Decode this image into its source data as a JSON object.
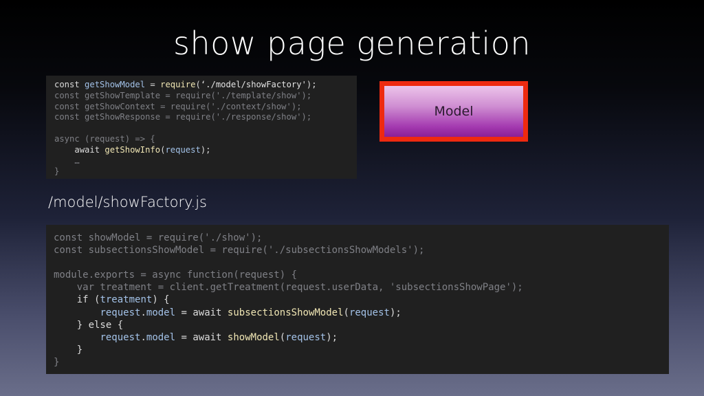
{
  "slide": {
    "title": "show page generation",
    "file_label": "/model/showFactory.js",
    "model_label": "Model"
  },
  "colors": {
    "model_border": "#ee2a10",
    "model_fill_top": "#ecc4ea",
    "model_fill_bottom": "#8a1f97",
    "code_background": "#202020"
  },
  "code_top": [
    {
      "indent": "",
      "parts": [
        {
          "t": "const ",
          "c": "hl"
        },
        {
          "t": "getShowModel",
          "c": "id"
        },
        {
          "t": " = ",
          "c": "hl"
        },
        {
          "t": "require",
          "c": "fn"
        },
        {
          "t": "(",
          "c": "hl"
        },
        {
          "t": "‘./model/showFactory'",
          "c": "str"
        },
        {
          "t": ");",
          "c": "hl"
        }
      ]
    },
    {
      "indent": "",
      "parts": [
        {
          "t": "const getShowTemplate = require('./template/show');",
          "c": ""
        }
      ]
    },
    {
      "indent": "",
      "parts": [
        {
          "t": "const getShowContext = require('./context/show');",
          "c": ""
        }
      ]
    },
    {
      "indent": "",
      "parts": [
        {
          "t": "const getShowResponse = require('./response/show');",
          "c": ""
        }
      ]
    },
    {
      "indent": "",
      "parts": [
        {
          "t": "",
          "c": ""
        }
      ]
    },
    {
      "indent": "",
      "parts": [
        {
          "t": "async (request) => {",
          "c": ""
        }
      ]
    },
    {
      "indent": "    ",
      "parts": [
        {
          "t": "await ",
          "c": "hl"
        },
        {
          "t": "getShowInfo",
          "c": "fn"
        },
        {
          "t": "(",
          "c": "hl"
        },
        {
          "t": "request",
          "c": "id"
        },
        {
          "t": ");",
          "c": "hl"
        }
      ]
    },
    {
      "indent": "    ",
      "parts": [
        {
          "t": "…",
          "c": ""
        }
      ]
    },
    {
      "indent": "",
      "parts": [
        {
          "t": "}",
          "c": ""
        }
      ]
    }
  ],
  "code_bottom": [
    {
      "indent": "",
      "parts": [
        {
          "t": "const showModel = require('./show');",
          "c": ""
        }
      ]
    },
    {
      "indent": "",
      "parts": [
        {
          "t": "const subsectionsShowModel = require('./subsectionsShowModels');",
          "c": ""
        }
      ]
    },
    {
      "indent": "",
      "parts": [
        {
          "t": "",
          "c": ""
        }
      ]
    },
    {
      "indent": "",
      "parts": [
        {
          "t": "module.exports = async function(request) {",
          "c": ""
        }
      ]
    },
    {
      "indent": "    ",
      "parts": [
        {
          "t": "var treatment = client.getTreatment(request.userData, 'subsectionsShowPage');",
          "c": ""
        }
      ]
    },
    {
      "indent": "    ",
      "parts": [
        {
          "t": "if ",
          "c": "hl"
        },
        {
          "t": "(",
          "c": "hl"
        },
        {
          "t": "treatment",
          "c": "id"
        },
        {
          "t": ") {",
          "c": "hl"
        }
      ]
    },
    {
      "indent": "        ",
      "parts": [
        {
          "t": "request",
          "c": "id"
        },
        {
          "t": ".",
          "c": "hl"
        },
        {
          "t": "model",
          "c": "id"
        },
        {
          "t": " = ",
          "c": "hl"
        },
        {
          "t": "await ",
          "c": "hl"
        },
        {
          "t": "subsectionsShowModel",
          "c": "fn"
        },
        {
          "t": "(",
          "c": "hl"
        },
        {
          "t": "request",
          "c": "id"
        },
        {
          "t": ");",
          "c": "hl"
        }
      ]
    },
    {
      "indent": "    ",
      "parts": [
        {
          "t": "} else {",
          "c": "hl"
        }
      ]
    },
    {
      "indent": "        ",
      "parts": [
        {
          "t": "request",
          "c": "id"
        },
        {
          "t": ".",
          "c": "hl"
        },
        {
          "t": "model",
          "c": "id"
        },
        {
          "t": " = ",
          "c": "hl"
        },
        {
          "t": "await ",
          "c": "hl"
        },
        {
          "t": "showModel",
          "c": "fn"
        },
        {
          "t": "(",
          "c": "hl"
        },
        {
          "t": "request",
          "c": "id"
        },
        {
          "t": ");",
          "c": "hl"
        }
      ]
    },
    {
      "indent": "    ",
      "parts": [
        {
          "t": "}",
          "c": "hl"
        }
      ]
    },
    {
      "indent": "",
      "parts": [
        {
          "t": "}",
          "c": ""
        }
      ]
    }
  ]
}
